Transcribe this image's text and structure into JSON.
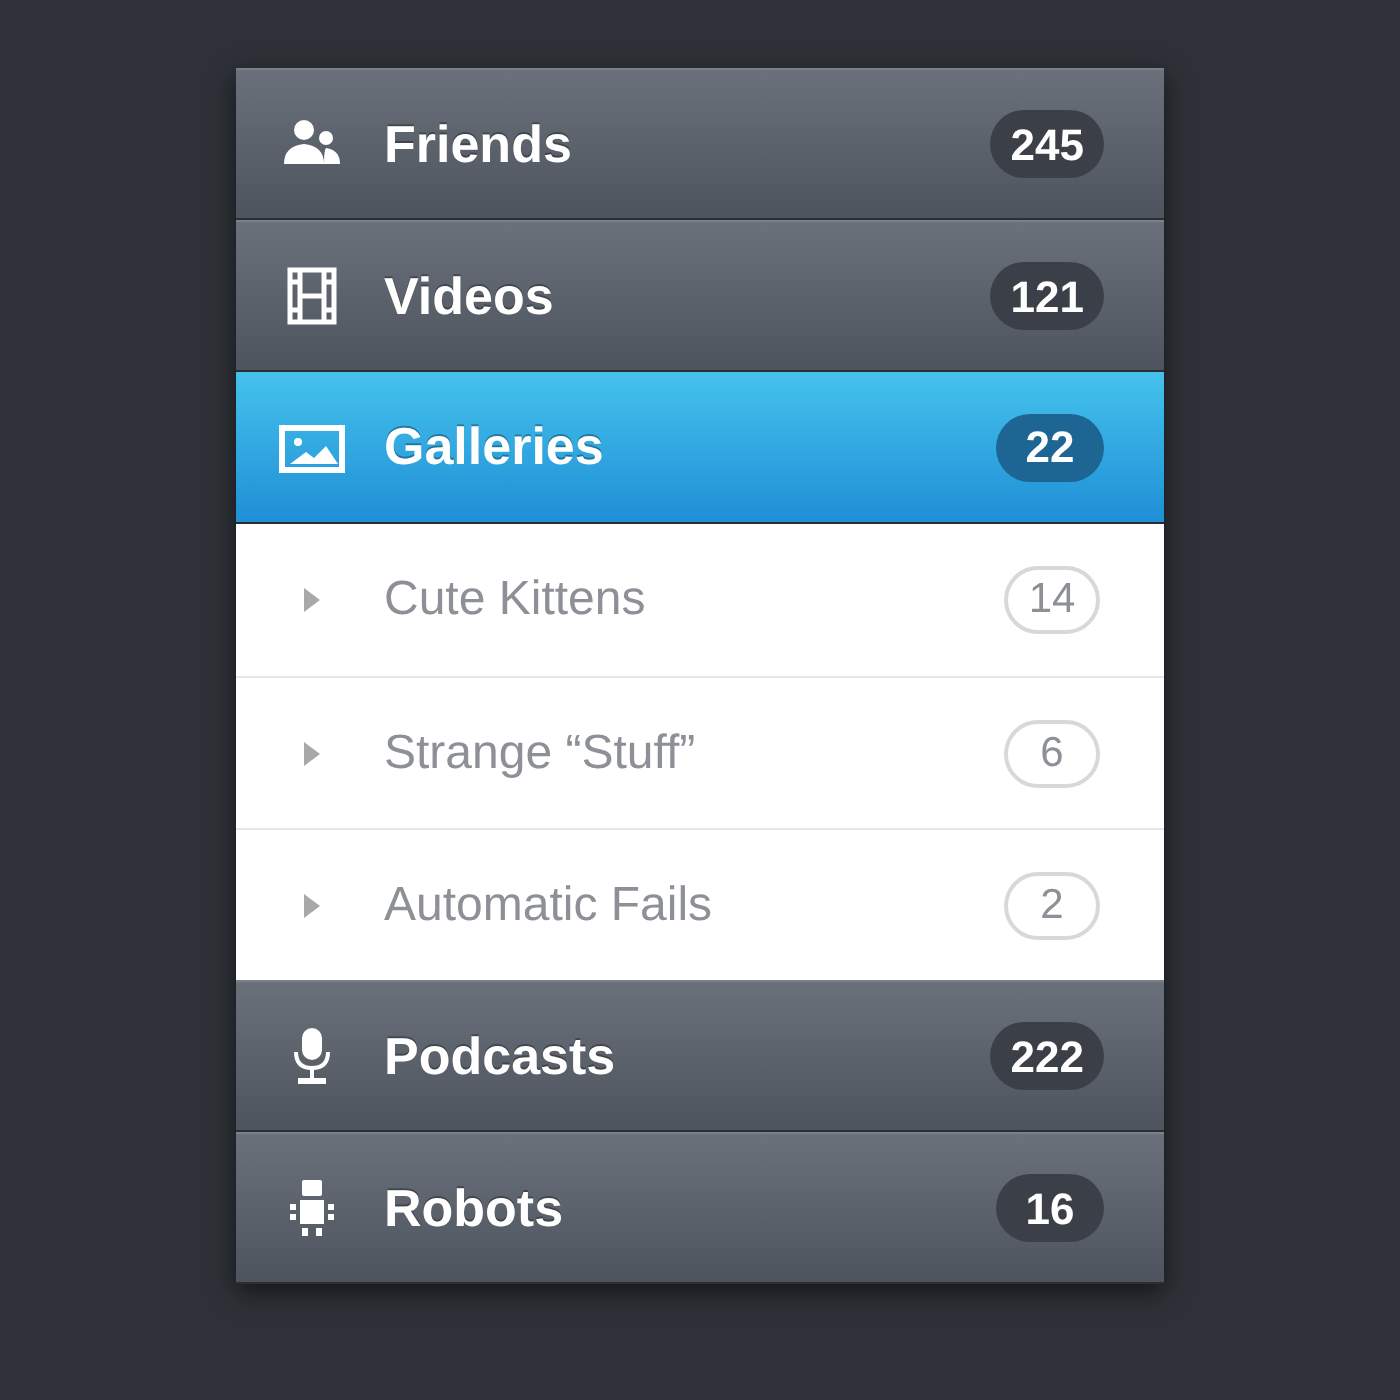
{
  "menu": {
    "items": [
      {
        "label": "Friends",
        "count": "245",
        "selected": false
      },
      {
        "label": "Videos",
        "count": "121",
        "selected": false
      },
      {
        "label": "Galleries",
        "count": "22",
        "selected": true,
        "children": [
          {
            "label": "Cute Kittens",
            "count": "14"
          },
          {
            "label": "Strange “Stuff”",
            "count": "6"
          },
          {
            "label": "Automatic Fails",
            "count": "2"
          }
        ]
      },
      {
        "label": "Podcasts",
        "count": "222",
        "selected": false
      },
      {
        "label": "Robots",
        "count": "16",
        "selected": false
      }
    ]
  }
}
